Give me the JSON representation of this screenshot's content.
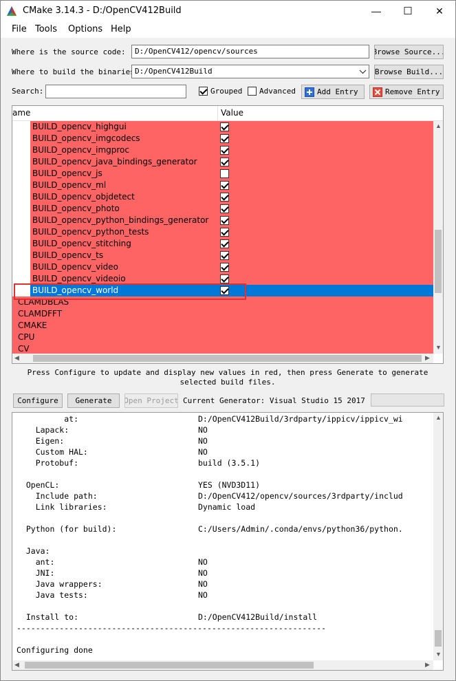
{
  "window": {
    "title": "CMake 3.14.3 - D:/OpenCV412Build",
    "minimize_glyph": "—",
    "maximize_glyph": "☐",
    "close_glyph": "✕"
  },
  "menu": [
    "File",
    "Tools",
    "Options",
    "Help"
  ],
  "source": {
    "label": "Where is the source code:",
    "value": "D:/OpenCV412/opencv/sources",
    "browse_label": "Browse Source..."
  },
  "build": {
    "label": "Where to build the binaries:",
    "value": "D:/OpenCV412Build",
    "browse_label": "Browse Build..."
  },
  "search": {
    "label": "Search:",
    "value": ""
  },
  "options": {
    "grouped_label": "Grouped",
    "grouped_checked": true,
    "advanced_label": "Advanced",
    "advanced_checked": false,
    "add_entry_label": "Add Entry",
    "remove_entry_label": "Remove Entry"
  },
  "table": {
    "col_name": "ame",
    "col_value": "Value",
    "rows": [
      {
        "name": "BUILD_opencv_highgui",
        "checked": true,
        "child": true,
        "selected": false
      },
      {
        "name": "BUILD_opencv_imgcodecs",
        "checked": true,
        "child": true,
        "selected": false
      },
      {
        "name": "BUILD_opencv_imgproc",
        "checked": true,
        "child": true,
        "selected": false
      },
      {
        "name": "BUILD_opencv_java_bindings_generator",
        "checked": true,
        "child": true,
        "selected": false
      },
      {
        "name": "BUILD_opencv_js",
        "checked": false,
        "child": true,
        "selected": false
      },
      {
        "name": "BUILD_opencv_ml",
        "checked": true,
        "child": true,
        "selected": false
      },
      {
        "name": "BUILD_opencv_objdetect",
        "checked": true,
        "child": true,
        "selected": false
      },
      {
        "name": "BUILD_opencv_photo",
        "checked": true,
        "child": true,
        "selected": false
      },
      {
        "name": "BUILD_opencv_python_bindings_generator",
        "checked": true,
        "child": true,
        "selected": false
      },
      {
        "name": "BUILD_opencv_python_tests",
        "checked": true,
        "child": true,
        "selected": false
      },
      {
        "name": "BUILD_opencv_stitching",
        "checked": true,
        "child": true,
        "selected": false
      },
      {
        "name": "BUILD_opencv_ts",
        "checked": true,
        "child": true,
        "selected": false
      },
      {
        "name": "BUILD_opencv_video",
        "checked": true,
        "child": true,
        "selected": false
      },
      {
        "name": "BUILD_opencv_videoio",
        "checked": true,
        "child": true,
        "selected": false
      },
      {
        "name": "BUILD_opencv_world",
        "checked": true,
        "child": true,
        "selected": true
      },
      {
        "name": "CLAMDBLAS",
        "checked": null,
        "child": false,
        "selected": false
      },
      {
        "name": "CLAMDFFT",
        "checked": null,
        "child": false,
        "selected": false
      },
      {
        "name": "CMAKE",
        "checked": null,
        "child": false,
        "selected": false
      },
      {
        "name": "CPU",
        "checked": null,
        "child": false,
        "selected": false
      },
      {
        "name": "CV",
        "checked": null,
        "child": false,
        "selected": false
      }
    ]
  },
  "hint": "Press Configure to update and display new values in red, then press Generate to generate selected build files.",
  "actions": {
    "configure_label": "Configure",
    "generate_label": "Generate",
    "open_project_label": "Open Project",
    "current_generator": "Current Generator: Visual Studio 15 2017"
  },
  "output": [
    {
      "label": "          at:",
      "value": "D:/OpenCV412Build/3rdparty/ippicv/ippicv_wi"
    },
    {
      "label": "    Lapack:",
      "value": "NO"
    },
    {
      "label": "    Eigen:",
      "value": "NO"
    },
    {
      "label": "    Custom HAL:",
      "value": "NO"
    },
    {
      "label": "    Protobuf:",
      "value": "build (3.5.1)"
    },
    {
      "label": "",
      "value": ""
    },
    {
      "label": "  OpenCL:",
      "value": "YES (NVD3D11)"
    },
    {
      "label": "    Include path:",
      "value": "D:/OpenCV412/opencv/sources/3rdparty/includ"
    },
    {
      "label": "    Link libraries:",
      "value": "Dynamic load"
    },
    {
      "label": "",
      "value": ""
    },
    {
      "label": "  Python (for build):",
      "value": "C:/Users/Admin/.conda/envs/python36/python."
    },
    {
      "label": "",
      "value": ""
    },
    {
      "label": "  Java:",
      "value": ""
    },
    {
      "label": "    ant:",
      "value": "NO"
    },
    {
      "label": "    JNI:",
      "value": "NO"
    },
    {
      "label": "    Java wrappers:",
      "value": "NO"
    },
    {
      "label": "    Java tests:",
      "value": "NO"
    },
    {
      "label": "",
      "value": ""
    },
    {
      "label": "  Install to:",
      "value": "D:/OpenCV412Build/install"
    },
    {
      "label": "-----------------------------------------------------------------",
      "value": ""
    },
    {
      "label": "",
      "value": ""
    },
    {
      "label": "Configuring done",
      "value": ""
    }
  ],
  "colors": {
    "changed_row": "#ff6464",
    "selected_row": "#0078d7",
    "highlight_box": "#e03030"
  }
}
